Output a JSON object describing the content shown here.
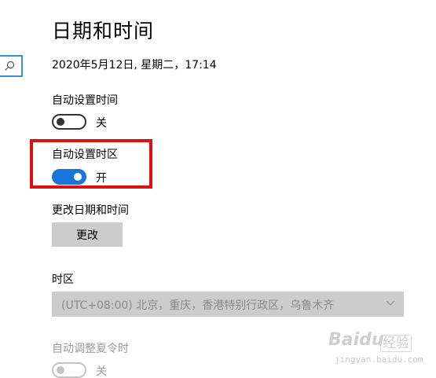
{
  "header": {
    "title": "日期和时间",
    "current_datetime": "2020年5月12日, 星期二，17:14"
  },
  "sidebar": {
    "search_icon": "search-icon"
  },
  "auto_time": {
    "label": "自动设置时间",
    "state": "off",
    "state_label": "关"
  },
  "auto_timezone": {
    "label": "自动设置时区",
    "state": "on",
    "state_label": "开",
    "highlight_color": "#dd1111"
  },
  "change_datetime": {
    "label": "更改日期和时间",
    "button_label": "更改"
  },
  "timezone": {
    "label": "时区",
    "selected": "(UTC+08:00) 北京，重庆，香港特别行政区，乌鲁木齐",
    "enabled": false
  },
  "daylight_saving": {
    "label": "自动调整夏令时",
    "state": "off",
    "state_label": "关",
    "enabled": false
  },
  "watermark": {
    "brand": "Baidu",
    "product": "经验",
    "site": "jingyan.baidu.com"
  },
  "colors": {
    "accent": "#1777d8",
    "disabled_text": "#9a9a9a",
    "button_bg": "#cccccc"
  }
}
